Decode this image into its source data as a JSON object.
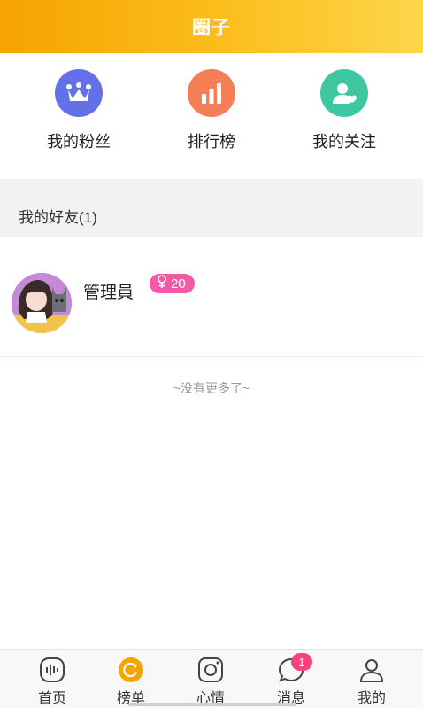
{
  "header": {
    "title": "圈子"
  },
  "quick_actions": [
    {
      "label": "我的粉丝",
      "icon": "crown-icon",
      "color": "#6470e8"
    },
    {
      "label": "排行榜",
      "icon": "bar-chart-icon",
      "color": "#f47e55"
    },
    {
      "label": "我的关注",
      "icon": "user-heart-icon",
      "color": "#3fc7a1"
    }
  ],
  "friends": {
    "title": "我的好友(1)",
    "items": [
      {
        "name": "管理員",
        "gender_icon": "female-icon",
        "level": "20",
        "badge_color": "#f25aa6"
      }
    ],
    "end_text": "~没有更多了~"
  },
  "tabbar": {
    "items": [
      {
        "label": "首页",
        "icon": "voice-wave-icon"
      },
      {
        "label": "榜单",
        "icon": "refresh-circle-icon",
        "active_color": "#f6a400"
      },
      {
        "label": "心情",
        "icon": "camera-icon"
      },
      {
        "label": "消息",
        "icon": "chat-bubble-icon",
        "badge": "1"
      },
      {
        "label": "我的",
        "icon": "user-icon"
      }
    ]
  }
}
